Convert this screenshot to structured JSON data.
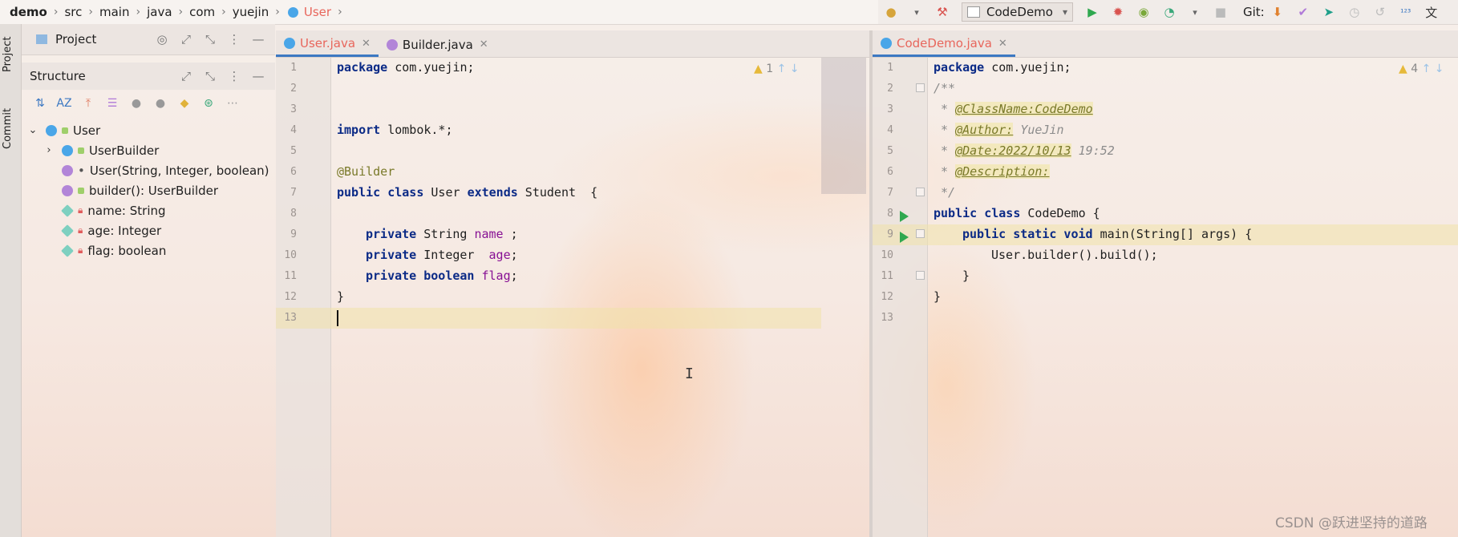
{
  "breadcrumb": {
    "items": [
      "demo",
      "src",
      "main",
      "java",
      "com",
      "yuejin",
      "User"
    ]
  },
  "toolbar": {
    "run_config": "CodeDemo",
    "git_label": "Git:"
  },
  "side_tabs": [
    "Project",
    "Commit"
  ],
  "project_panel": {
    "title": "Project"
  },
  "structure_panel": {
    "title": "Structure",
    "tree": [
      {
        "label": "User"
      },
      {
        "label": "UserBuilder"
      },
      {
        "label": "User(String, Integer, boolean)"
      },
      {
        "label": "builder(): UserBuilder"
      },
      {
        "label": "name: String"
      },
      {
        "label": "age: Integer"
      },
      {
        "label": "flag: boolean"
      }
    ]
  },
  "editor_left": {
    "tabs": [
      {
        "label": "User.java"
      },
      {
        "label": "Builder.java"
      }
    ],
    "line_numbers": [
      "1",
      "2",
      "3",
      "4",
      "5",
      "6",
      "7",
      "8",
      "9",
      "10",
      "11",
      "12",
      "13"
    ],
    "warning_count": "1"
  },
  "editor_right": {
    "tabs": [
      {
        "label": "CodeDemo.java"
      }
    ],
    "line_numbers": [
      "1",
      "2",
      "3",
      "4",
      "5",
      "6",
      "7",
      "8",
      "9",
      "10",
      "11",
      "12",
      "13"
    ],
    "warning_count": "4"
  },
  "code_left": {
    "l1_kw": "package",
    "l1_rest": " com.yuejin;",
    "l4_kw": "import",
    "l4_rest": " lombok.*;",
    "l6": "@Builder",
    "l7_kw1": "public class",
    "l7_mid": " User ",
    "l7_kw2": "extends",
    "l7_rest": " Student  {",
    "l9_kw": "private",
    "l9_type": " String ",
    "l9_name": "name",
    "l9_end": " ;",
    "l10_kw": "private",
    "l10_type": " Integer  ",
    "l10_name": "age",
    "l10_end": ";",
    "l11_kw": "private boolean",
    "l11_name": "flag",
    "l11_end": ";",
    "l12": "}"
  },
  "code_right": {
    "l1_kw": "package",
    "l1_rest": " com.yuejin;",
    "l2": "/**",
    "l3_pre": " * ",
    "l3_tag": "@ClassName:CodeDemo",
    "l4_pre": " * ",
    "l4_tag": "@Author:",
    "l4_rest": " YueJin",
    "l5_pre": " * ",
    "l5_tag": "@Date:2022/10/13",
    "l5_rest": " 19:52",
    "l6_pre": " * ",
    "l6_tag": "@Description:",
    "l7": " */",
    "l8_kw": "public class",
    "l8_rest": " CodeDemo {",
    "l9_kw": "public static void",
    "l9_rest": " main(String[] args) {",
    "l10": "User.builder().build();",
    "l11": "}",
    "l12": "}"
  },
  "watermark": "CSDN @跃进坚持的道路"
}
